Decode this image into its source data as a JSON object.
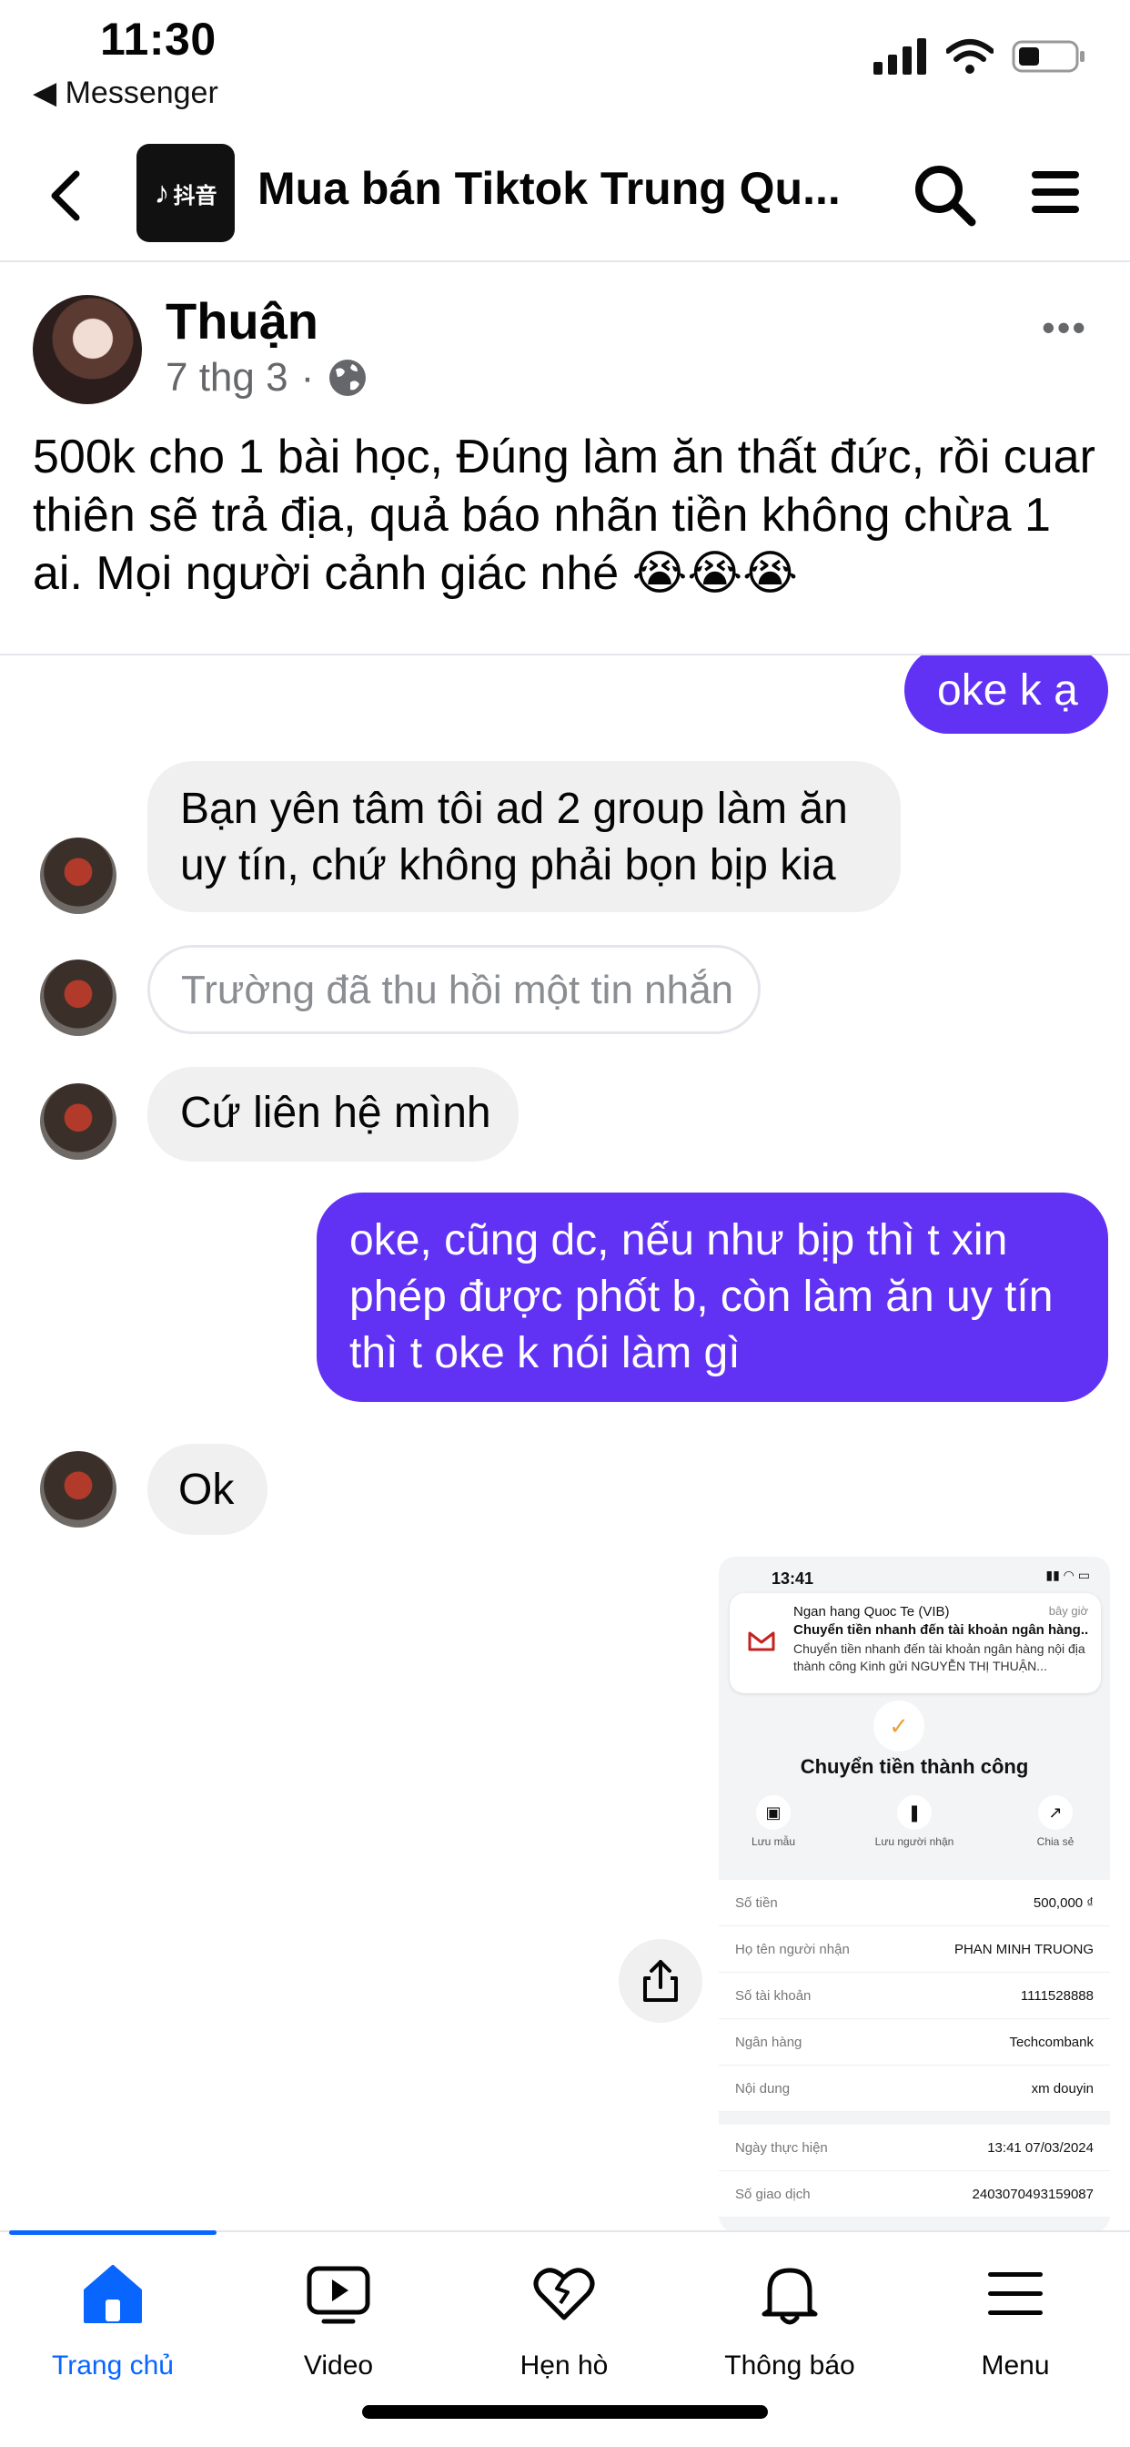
{
  "status_bar": {
    "time": "11:30",
    "back_app": "◀ Messenger",
    "icons": [
      "signal-icon",
      "wifi-icon",
      "battery-icon"
    ]
  },
  "header": {
    "group_logo_text": "抖音",
    "title": "Mua bán Tiktok Trung Qu...",
    "icons": [
      "back-icon",
      "search-icon",
      "menu-icon"
    ]
  },
  "post": {
    "author": "Thuận",
    "date": "7 thg 3",
    "separator": "·",
    "text": "500k cho 1 bài học, Đúng làm ăn thất đức, rồi cuar thiên sẽ trả địa, quả báo nhãn tiền không chừa 1 ai. Mọi người cảnh giác nhé 😭😭😭"
  },
  "chat": {
    "messages": [
      {
        "side": "out",
        "text": "oke k ạ"
      },
      {
        "side": "in",
        "text": "Bạn yên tâm tôi ad 2 group làm ăn uy tín, chứ không phải bọn bịp kia"
      },
      {
        "side": "in",
        "recalled": true,
        "text": "Trường đã thu hồi một tin nhắn"
      },
      {
        "side": "in",
        "text": "Cứ liên hệ mình"
      },
      {
        "side": "out",
        "text": "oke, cũng dc, nếu như bịp thì t xin phép được phốt b, còn làm ăn uy tín thì t oke k nói làm gì"
      },
      {
        "side": "in",
        "text": "Ok"
      }
    ],
    "receipt": {
      "status_time": "13:41",
      "notif_sender": "Ngan hang Quoc Te (VIB)",
      "notif_time": "bây giờ",
      "notif_title": "Chuyển tiền nhanh đến tài khoản ngân hàng...",
      "notif_body": "Chuyển tiền nhanh đến tài khoản ngân hàng nội địa thành công Kinh gửi NGUYỄN THỊ THUẬN...",
      "title": "Chuyển tiền thành công",
      "actions": [
        "Lưu mẫu",
        "Lưu người nhận",
        "Chia sẻ"
      ],
      "rows": [
        {
          "label": "Số tiền",
          "value": "500,000 ₫"
        },
        {
          "label": "Họ tên người nhận",
          "value": "PHAN MINH TRUONG"
        },
        {
          "label": "Số tài khoản",
          "value": "1111528888"
        },
        {
          "label": "Ngân hàng",
          "value": "Techcombank"
        },
        {
          "label": "Nội dung",
          "value": "xm douyin"
        }
      ],
      "rows2": [
        {
          "label": "Ngày thực hiện",
          "value": "13:41 07/03/2024"
        },
        {
          "label": "Số giao dịch",
          "value": "2403070493159087"
        }
      ]
    }
  },
  "tabs": [
    {
      "label": "Trang chủ",
      "icon": "home-icon",
      "active": true
    },
    {
      "label": "Video",
      "icon": "video-icon",
      "active": false
    },
    {
      "label": "Hẹn hò",
      "icon": "heart-icon",
      "active": false
    },
    {
      "label": "Thông báo",
      "icon": "bell-icon",
      "active": false
    },
    {
      "label": "Menu",
      "icon": "menu-lines-icon",
      "active": false
    }
  ],
  "colors": {
    "accent": "#0866ff",
    "outgoing_bubble": "#6132f4",
    "incoming_bubble": "#f0f0f0",
    "secondary_text": "#65676b"
  }
}
